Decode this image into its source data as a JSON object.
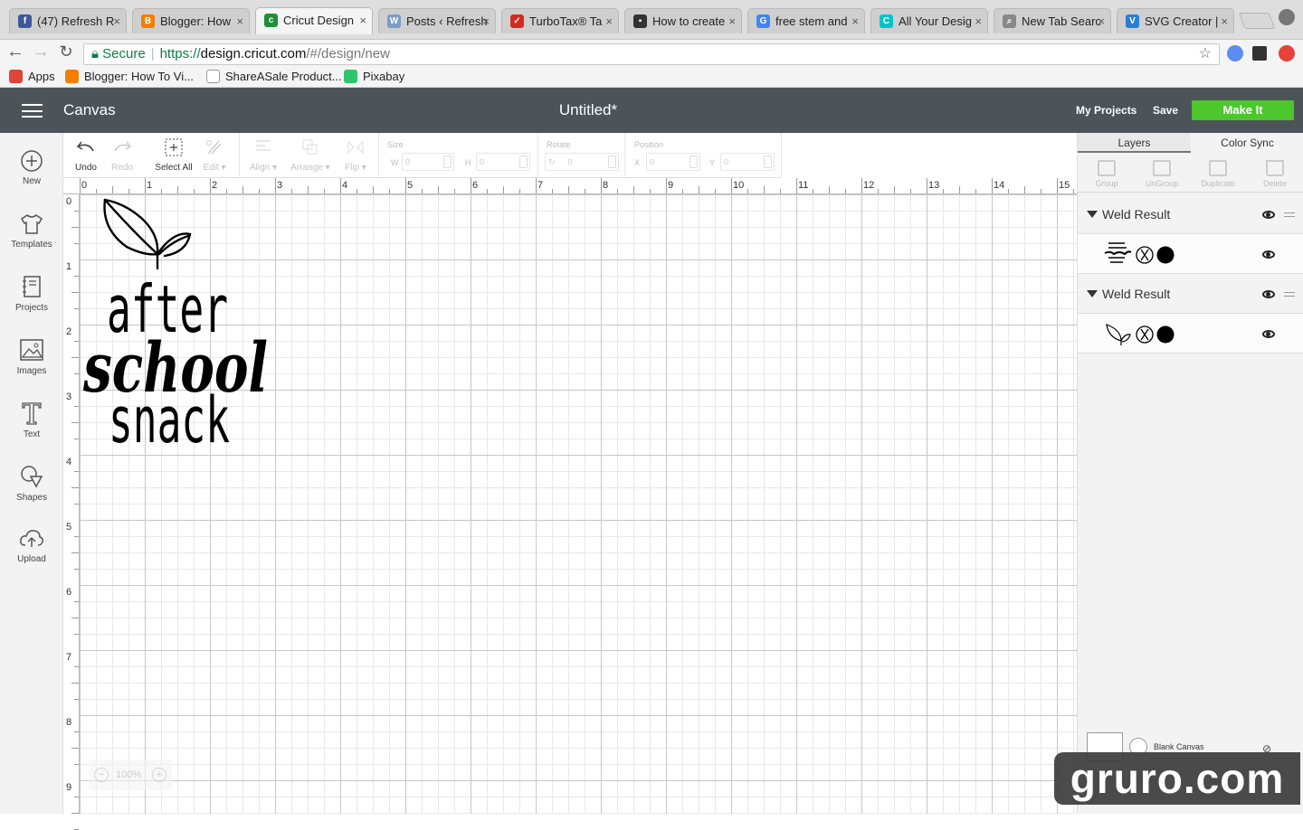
{
  "browser": {
    "tabs": [
      {
        "title": "(47) Refresh R",
        "icon": "facebook-icon",
        "color": "#3b5998",
        "glyph": "f"
      },
      {
        "title": "Blogger: How",
        "icon": "blogger-icon",
        "color": "#f57d00",
        "glyph": "B"
      },
      {
        "title": "Cricut Design",
        "icon": "cricut-icon",
        "color": "#1f8f3a",
        "glyph": "c",
        "active": true
      },
      {
        "title": "Posts ‹ Refresh",
        "icon": "wordpress-icon",
        "color": "#7a9cc6",
        "glyph": "W"
      },
      {
        "title": "TurboTax® Ta",
        "icon": "turbotax-icon",
        "color": "#d52b1e",
        "glyph": "✓"
      },
      {
        "title": "How to create",
        "icon": "page-icon",
        "color": "#333333",
        "glyph": "▪"
      },
      {
        "title": "free stem and",
        "icon": "google-icon",
        "color": "#4285f4",
        "glyph": "G"
      },
      {
        "title": "All Your Desig",
        "icon": "canva-icon",
        "color": "#00c4cc",
        "glyph": "C"
      },
      {
        "title": "New Tab Searc",
        "icon": "search-icon",
        "color": "#888888",
        "glyph": "⌕"
      },
      {
        "title": "SVG Creator |",
        "icon": "svg-creator-icon",
        "color": "#2a7fd4",
        "glyph": "V"
      }
    ],
    "url": {
      "secure_label": "Secure",
      "scheme": "https://",
      "host": "design.cricut.com",
      "path": "/#/design/new"
    },
    "bookmarks": [
      {
        "label": "Apps",
        "icon": "apps-grid-icon",
        "color": "#e0453a"
      },
      {
        "label": "Blogger: How To Vi...",
        "icon": "blogger-icon",
        "color": "#f57d00"
      },
      {
        "label": "ShareASale Product...",
        "icon": "page-icon",
        "color": "#ffffff"
      },
      {
        "label": "Pixabay",
        "icon": "pixabay-icon",
        "color": "#2ec66d"
      }
    ]
  },
  "app": {
    "name": "Canvas",
    "doc_title": "Untitled*",
    "my_projects": "My Projects",
    "save": "Save",
    "make_it": "Make It",
    "accent": "#4cc72c",
    "header_bg": "#4c545a"
  },
  "left_nav": [
    {
      "label": "New",
      "icon": "plus-circle-icon"
    },
    {
      "label": "Templates",
      "icon": "tshirt-icon"
    },
    {
      "label": "Projects",
      "icon": "projects-icon"
    },
    {
      "label": "Images",
      "icon": "image-icon"
    },
    {
      "label": "Text",
      "icon": "text-icon"
    },
    {
      "label": "Shapes",
      "icon": "shapes-icon"
    },
    {
      "label": "Upload",
      "icon": "cloud-upload-icon"
    }
  ],
  "toolbar": {
    "undo": "Undo",
    "redo": "Redo",
    "select_all": "Select All",
    "edit": "Edit",
    "align": "Align",
    "arrange": "Arrange",
    "flip": "Flip",
    "size": "Size",
    "w": "W",
    "h": "H",
    "rotate": "Rotate",
    "position": "Position",
    "x": "X",
    "y": "Y",
    "field_value": "0"
  },
  "ruler": {
    "top": [
      "0",
      "1",
      "2",
      "3",
      "4",
      "5",
      "6",
      "7",
      "8",
      "9",
      "10",
      "11",
      "12",
      "13",
      "14",
      "15"
    ],
    "left": [
      "0",
      "1",
      "2",
      "3",
      "4",
      "5",
      "6",
      "7",
      "8",
      "9"
    ]
  },
  "canvas_design": {
    "lines": [
      "after",
      "school",
      "snack"
    ]
  },
  "zoom": {
    "value": "100%",
    "minus": "−",
    "plus": "+"
  },
  "right_panel": {
    "tabs": [
      "Layers",
      "Color Sync"
    ],
    "actions": [
      "Group",
      "UnGroup",
      "Duplicate",
      "Delete"
    ],
    "layers": [
      {
        "name": "Weld Result",
        "thumb": "after-school-snack-thumb"
      },
      {
        "name": "Weld Result",
        "thumb": "leaf-thumb"
      }
    ],
    "blank_canvas": "Blank Canvas"
  },
  "watermark": "gruro.com"
}
